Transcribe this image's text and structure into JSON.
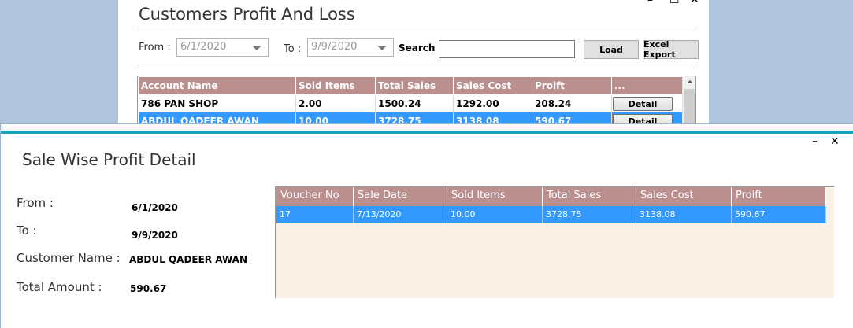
{
  "back_window": {
    "title": "Customers Profit And Loss",
    "controls": {
      "minimize": "–",
      "maximize": "☐",
      "close": "✕"
    },
    "filters": {
      "from_label": "From :",
      "from_value": "6/1/2020",
      "to_label": "To :",
      "to_value": "9/9/2020",
      "search_label": "Search :",
      "search_value": ""
    },
    "buttons": {
      "load": "Load",
      "excel_export": "Excel Export"
    },
    "table": {
      "columns": [
        "Account Name",
        "Sold Items",
        "Total Sales",
        "Sales Cost",
        "Proift",
        "..."
      ],
      "rows": [
        {
          "account": "786 PAN SHOP",
          "sold": "2.00",
          "sales": "1500.24",
          "cost": "1292.00",
          "profit": "208.24",
          "action": "Detail"
        },
        {
          "account": "ABDUL QADEER AWAN",
          "sold": "10.00",
          "sales": "3728.75",
          "cost": "3138.08",
          "profit": "590.67",
          "action": "Detail"
        }
      ]
    }
  },
  "dialog": {
    "title": "Sale Wise Profit Detail",
    "controls": {
      "minimize": "–",
      "close": "✕"
    },
    "fields": {
      "from_label": "From :",
      "from_value": "6/1/2020",
      "to_label": "To :",
      "to_value": "9/9/2020",
      "customer_label": "Customer Name :",
      "customer_value": "ABDUL QADEER AWAN",
      "total_label": "Total Amount :",
      "total_value": "590.67"
    },
    "table": {
      "columns": [
        "Voucher No",
        "Sale Date",
        "Sold Items",
        "Total Sales",
        "Sales Cost",
        "Proift"
      ],
      "rows": [
        {
          "voucher": "17",
          "date": "7/13/2020",
          "sold": "10.00",
          "sales": "3728.75",
          "cost": "3138.08",
          "profit": "590.67"
        }
      ]
    }
  },
  "colors": {
    "header_bg": "#bc8f8f",
    "selection_bg": "#3399ff",
    "grid_bg": "#faf0e6",
    "desktop_bg": "#b0c4de",
    "accent_bar": "#17a2b8"
  }
}
